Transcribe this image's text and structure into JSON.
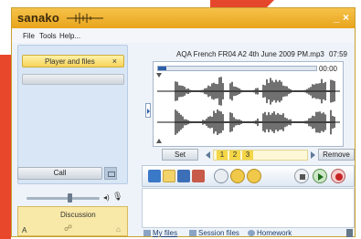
{
  "window": {
    "app_name": "sanako",
    "minimize": "_",
    "close": "×"
  },
  "menu": {
    "items": [
      "File",
      "Tools",
      "Help..."
    ]
  },
  "left_panel": {
    "player_tab_label": "Player and files",
    "player_tab_close": "×",
    "call_label": "Call",
    "discussion_label": "Discussion",
    "discussion_letter": "A",
    "volume_level": 0.6
  },
  "player": {
    "file_title": "AQA French FR04 A2 4th June 2009 PM.mp3",
    "total_time": "07:59",
    "current_time": "00:00",
    "progress": 0.05,
    "set_label": "Set",
    "remove_label": "Remove",
    "bookmarks": [
      "1",
      "2",
      "3"
    ]
  },
  "toolbar": {
    "icons": [
      "monitor-icon",
      "folder-open-icon",
      "save-icon",
      "audio-settings-icon",
      "ab-repeat-icon",
      "loop-icon",
      "export-icon",
      "stop-icon",
      "play-icon",
      "record-icon"
    ]
  },
  "tabs": {
    "my_files": "My files",
    "session_files": "Session files",
    "homework": "Homework"
  },
  "colors": {
    "title_bar": "#f0b02e",
    "accent_blue": "#2d5fa8",
    "bookmark_yellow": "#f4d646",
    "record_red": "#c62424",
    "play_green": "#1d6b1d"
  }
}
